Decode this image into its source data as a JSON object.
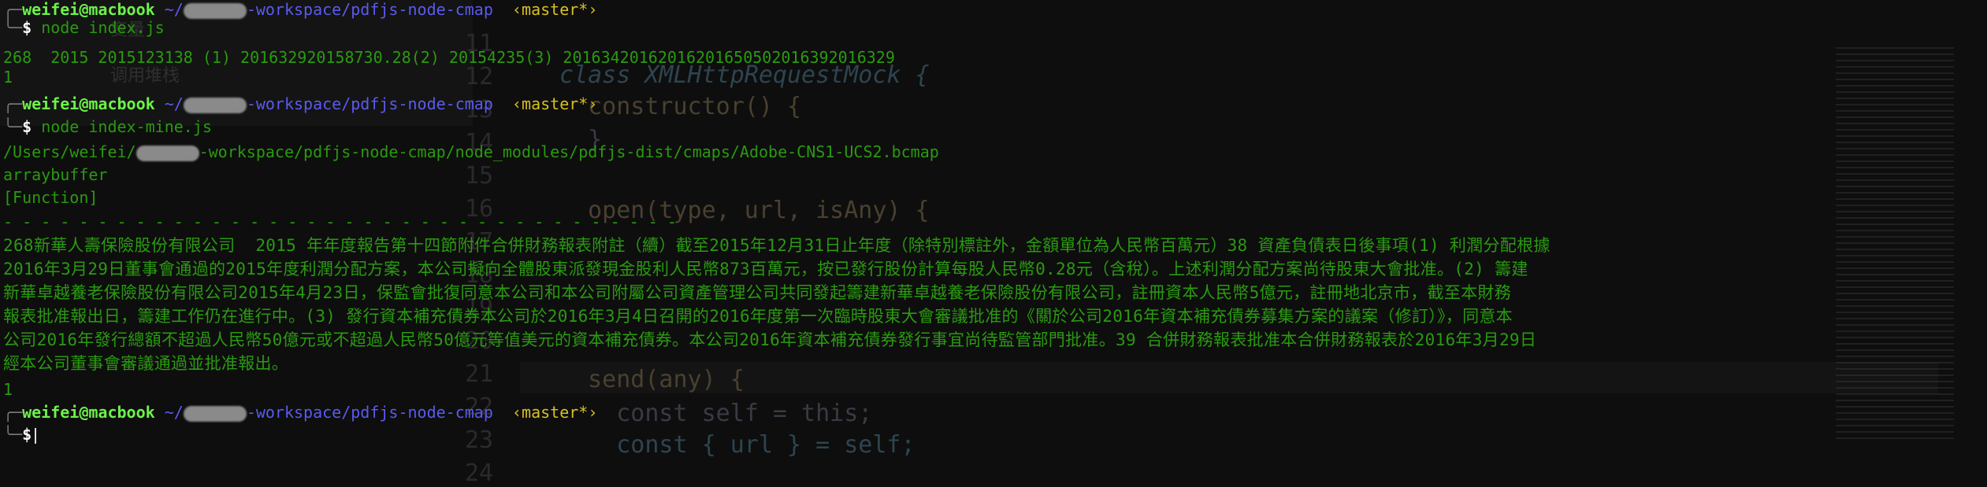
{
  "prompt": {
    "user": "weifei@macbook",
    "path_prefix": "~/",
    "path_suffix": "-workspace/pdfjs-node-cmap",
    "branch": "‹master*›",
    "symbol": "$"
  },
  "commands": [
    "node index.js",
    "node index-mine.js"
  ],
  "output1": [
    "268  2015 2015123138 (1) 201632920158730.28(2) 20154235(3) 20163420162016201650502016392016329",
    "1"
  ],
  "output2": {
    "path_prefix": "/Users/weifei/",
    "path_suffix": "-workspace/pdfjs-node-cmap/node_modules/pdfjs-dist/cmaps/Adobe-CNS1-UCS2.bcmap",
    "lines": [
      "arraybuffer",
      "[Function]"
    ],
    "separator": "- - - - - - - - - - - - - - - - - - - - - - - - - - - - - - - - - - - -",
    "text": [
      "268新華人壽保險股份有限公司  2015 年年度報告第十四節附件合併財務報表附註（續）截至2015年12月31日止年度（除特別標註外，金額單位為人民幣百萬元）38 資產負債表日後事項(1) 利潤分配根據",
      "2016年3月29日董事會通過的2015年度利潤分配方案，本公司擬向全體股東派發現金股利人民幣873百萬元，按已發行股份計算每股人民幣0.28元（含稅）。上述利潤分配方案尚待股東大會批准。(2) 籌建",
      "新華卓越養老保險股份有限公司2015年4月23日，保監會批復同意本公司和本公司附屬公司資產管理公司共同發起籌建新華卓越養老保險股份有限公司，註冊資本人民幣5億元，註冊地北京市，截至本財務",
      "報表批准報出日，籌建工作仍在進行中。(3) 發行資本補充債券本公司於2016年3月4日召開的2016年度第一次臨時股東大會審議批准的《關於公司2016年資本補充債券募集方案的議案（修訂）》，同意本",
      "公司2016年發行總額不超過人民幣50億元或不超過人民幣50億元等值美元的資本補充債券。本公司2016年資本補充債券發行事宜尚待監管部門批准。39 合併財務報表批准本合併財務報表於2016年3月29日",
      "經本公司董事會審議通過並批准報出。"
    ],
    "result": "1"
  },
  "background_editor": {
    "panel_labels": [
      "变量",
      "调用堆栈"
    ],
    "line_numbers": [
      "11",
      "12",
      "13",
      "14",
      "15",
      "16",
      "17",
      "18",
      "19",
      "20",
      "21",
      "22",
      "23",
      "24"
    ],
    "code": {
      "11": "",
      "12": "class XMLHttpRequestMock {",
      "13": "  constructor() {",
      "14": "  }",
      "16": "  open(type, url, isAny) {",
      "21": "  send(any) {",
      "22": "    const self = this;",
      "23": "    const { url } = self;"
    }
  }
}
